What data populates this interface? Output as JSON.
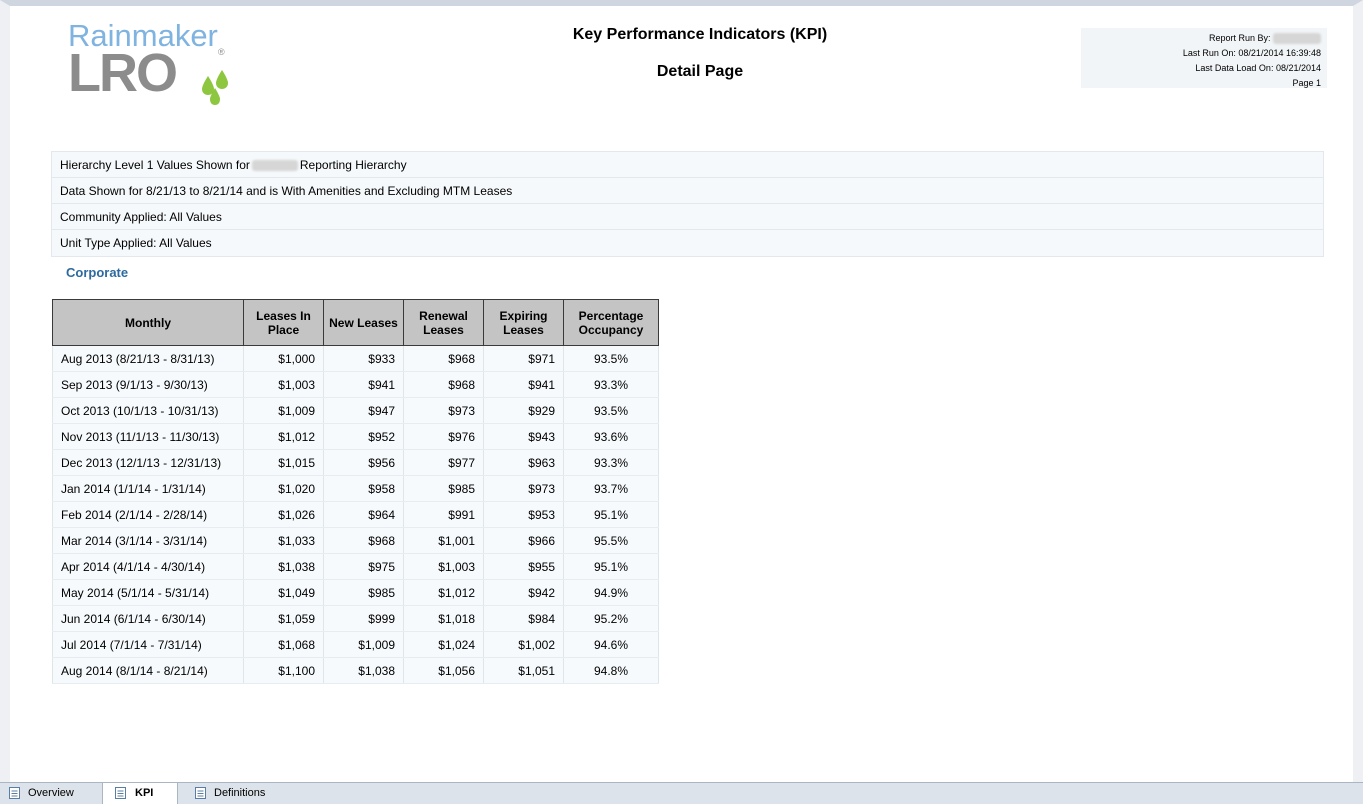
{
  "logo": {
    "top": "Rainmaker",
    "bottom": "LRO",
    "reg": "®"
  },
  "report": {
    "title": "Key Performance Indicators (KPI)",
    "subtitle": "Detail Page"
  },
  "runinfo": {
    "run_by": "Report Run By:",
    "last_run": "Last Run On: 08/21/2014 16:39:48",
    "last_load": "Last Data Load On: 08/21/2014",
    "page": "Page 1"
  },
  "filters": {
    "hierarchy_prefix": "Hierarchy Level 1 Values Shown for",
    "hierarchy_suffix": "Reporting Hierarchy",
    "data_shown": "Data Shown for 8/21/13 to 8/21/14 and is With Amenities and Excluding MTM Leases",
    "community": "Community Applied: All Values",
    "unit_type": "Unit Type Applied: All Values"
  },
  "section_title": "Corporate",
  "table": {
    "headers": [
      "Monthly",
      "Leases In Place",
      "New Leases",
      "Renewal Leases",
      "Expiring Leases",
      "Percentage Occupancy"
    ],
    "rows": [
      [
        "Aug 2013 (8/21/13 - 8/31/13)",
        "$1,000",
        "$933",
        "$968",
        "$971",
        "93.5%"
      ],
      [
        "Sep 2013 (9/1/13 - 9/30/13)",
        "$1,003",
        "$941",
        "$968",
        "$941",
        "93.3%"
      ],
      [
        "Oct 2013 (10/1/13 - 10/31/13)",
        "$1,009",
        "$947",
        "$973",
        "$929",
        "93.5%"
      ],
      [
        "Nov 2013 (11/1/13 - 11/30/13)",
        "$1,012",
        "$952",
        "$976",
        "$943",
        "93.6%"
      ],
      [
        "Dec 2013 (12/1/13 - 12/31/13)",
        "$1,015",
        "$956",
        "$977",
        "$963",
        "93.3%"
      ],
      [
        "Jan 2014 (1/1/14 - 1/31/14)",
        "$1,020",
        "$958",
        "$985",
        "$973",
        "93.7%"
      ],
      [
        "Feb 2014 (2/1/14 - 2/28/14)",
        "$1,026",
        "$964",
        "$991",
        "$953",
        "95.1%"
      ],
      [
        "Mar 2014 (3/1/14 - 3/31/14)",
        "$1,033",
        "$968",
        "$1,001",
        "$966",
        "95.5%"
      ],
      [
        "Apr 2014 (4/1/14 - 4/30/14)",
        "$1,038",
        "$975",
        "$1,003",
        "$955",
        "95.1%"
      ],
      [
        "May 2014 (5/1/14 - 5/31/14)",
        "$1,049",
        "$985",
        "$1,012",
        "$942",
        "94.9%"
      ],
      [
        "Jun 2014 (6/1/14 - 6/30/14)",
        "$1,059",
        "$999",
        "$1,018",
        "$984",
        "95.2%"
      ],
      [
        "Jul 2014 (7/1/14 - 7/31/14)",
        "$1,068",
        "$1,009",
        "$1,024",
        "$1,002",
        "94.6%"
      ],
      [
        "Aug 2014 (8/1/14 - 8/21/14)",
        "$1,100",
        "$1,038",
        "$1,056",
        "$1,051",
        "94.8%"
      ]
    ]
  },
  "tabs": [
    {
      "label": "Overview",
      "icon": "document-icon"
    },
    {
      "label": "KPI",
      "icon": "document-icon",
      "active": true
    },
    {
      "label": "Definitions",
      "icon": "document-icon"
    }
  ],
  "colors": {
    "logo_blue": "#7fb3e0",
    "logo_gray": "#8c8c8c",
    "logo_green": "#8dc63f",
    "section_blue": "#2d6a9f"
  }
}
